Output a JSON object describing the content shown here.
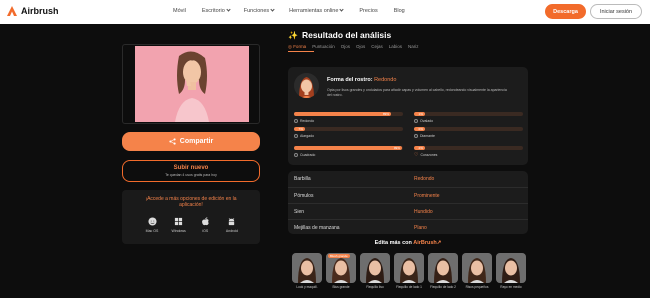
{
  "nav": {
    "brand": "Airbrush",
    "items": [
      "Móvil",
      "Escritorio",
      "Funciones",
      "Herramientas online",
      "Precios",
      "Blog"
    ],
    "download": "Descarga",
    "login": "Iniciar sesión"
  },
  "left": {
    "share": "Compartir",
    "upload_title": "Subir nuevo",
    "upload_sub": "Te quedan 4 usos gratis para hoy",
    "apps_title": "¡Accede a más opciones de edición en la aplicación!",
    "apps": [
      {
        "label": "Mac OS",
        "icon": "finder-icon"
      },
      {
        "label": "Windows",
        "icon": "windows-icon"
      },
      {
        "label": "iOS",
        "icon": "apple-icon"
      },
      {
        "label": "Android",
        "icon": "android-icon"
      }
    ]
  },
  "result": {
    "title": "Resultado del análisis",
    "tabs": [
      "Forma",
      "Puntuación",
      "Ojos",
      "Ojos",
      "Cejas",
      "Labios",
      "Nariz"
    ],
    "shape_label": "Forma del rostro:",
    "shape_value": "Redondo",
    "description": "Opta por lisos grandes y ondulados para añadir capas y volumen al cabello, redondeando visualmente la apariencia del rostro.",
    "bars": [
      {
        "label": "Redondo",
        "pct": "89%",
        "fill": 0.89,
        "mark": "radio"
      },
      {
        "label": "Ovalado",
        "pct": "1%",
        "fill": 0.1,
        "mark": "radio"
      },
      {
        "label": "Alargado",
        "pct": "7%",
        "fill": 0.1,
        "mark": "radio"
      },
      {
        "label": "Diamante",
        "pct": "0%",
        "fill": 0.1,
        "mark": "radio"
      },
      {
        "label": "Cuadrado",
        "pct": "99%",
        "fill": 0.99,
        "mark": "radio"
      },
      {
        "label": "Corazones",
        "pct": "2%",
        "fill": 0.1,
        "mark": "heart"
      }
    ],
    "traits": [
      {
        "key": "Barbilla",
        "value": "Redondo"
      },
      {
        "key": "Pómulos",
        "value": "Prominente"
      },
      {
        "key": "Sien",
        "value": "Hundido"
      },
      {
        "key": "Mejillas de manzana",
        "value": "Plano"
      }
    ]
  },
  "edit": {
    "title_prefix": "Edita más con",
    "brand": "AirBrush",
    "tag": "Blush grande",
    "thumbs": [
      "Look y maquill.",
      "Blus grande",
      "Flequillo liso",
      "Flequillo de lado 1",
      "Flequillo de lado 2",
      "Risos pequeños",
      "Rayo en medio"
    ]
  },
  "colors": {
    "accent": "#f5834a",
    "bg": "#0d0d0d",
    "card": "#1c1c1c"
  }
}
